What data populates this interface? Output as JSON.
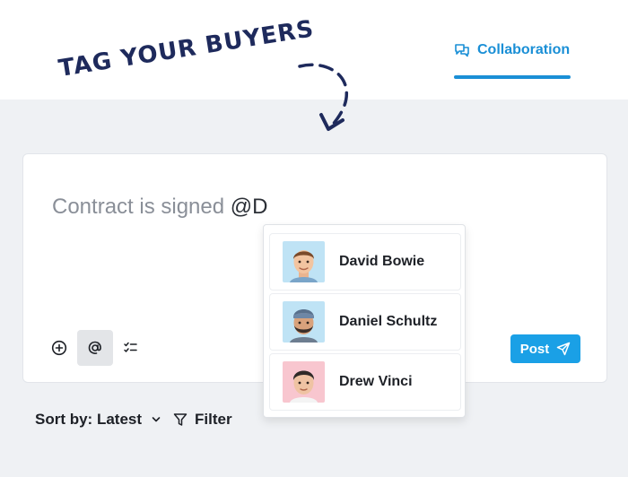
{
  "annotation": {
    "text": "TAG YOUR BUYERS"
  },
  "header": {
    "tab_label": "Collaboration",
    "tab_icon": "chat-bubbles-icon"
  },
  "composer": {
    "text": "Contract is signed",
    "mention": "@D"
  },
  "toolbar": {
    "post_label": "Post"
  },
  "mention_dropdown": {
    "users": [
      {
        "name": "David Bowie",
        "avatar_bg": "#bfe3f5"
      },
      {
        "name": "Daniel Schultz",
        "avatar_bg": "#bfe3f5"
      },
      {
        "name": "Drew Vinci",
        "avatar_bg": "#f8c6cf"
      }
    ]
  },
  "footer": {
    "sort_label": "Sort by: Latest",
    "filter_label": "Filter"
  },
  "colors": {
    "accent": "#1a8fd6",
    "post_button": "#1aa0e6",
    "annotation": "#1e2a5c"
  }
}
